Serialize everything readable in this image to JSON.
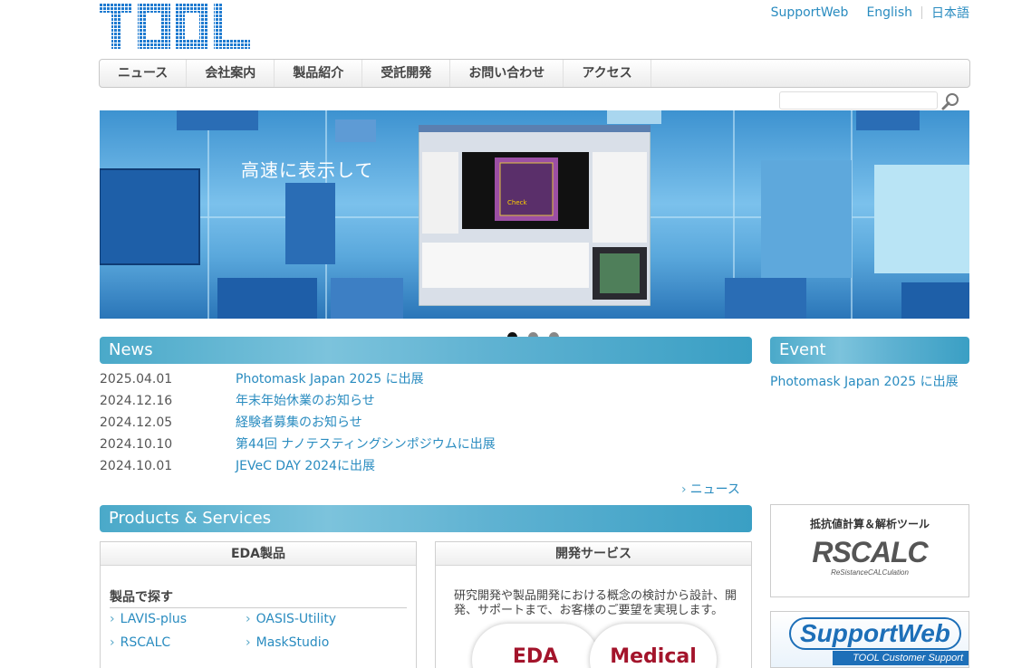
{
  "header": {
    "logo_text": "TOOL",
    "links": [
      "SupportWeb",
      "English",
      "日本語"
    ]
  },
  "nav": {
    "items": [
      "ニュース",
      "会社案内",
      "製品紹介",
      "受託開発",
      "お問い合わせ",
      "アクセス"
    ]
  },
  "search": {
    "value": ""
  },
  "hero": {
    "caption": "高速に表示して",
    "check_label": "Check",
    "slides": 3,
    "active_slide": 1
  },
  "news": {
    "title": "News",
    "items": [
      {
        "date": "2025.04.01",
        "title": "Photomask Japan 2025 に出展"
      },
      {
        "date": "2024.12.16",
        "title": "年末年始休業のお知らせ"
      },
      {
        "date": "2024.12.05",
        "title": "経験者募集のお知らせ"
      },
      {
        "date": "2024.10.10",
        "title": "第44回 ナノテスティングシンポジウムに出展"
      },
      {
        "date": "2024.10.01",
        "title": "JEVeC DAY 2024に出展"
      }
    ],
    "more_label": "ニュース"
  },
  "event": {
    "title": "Event",
    "items": [
      "Photomask Japan 2025 に出展"
    ]
  },
  "products": {
    "title": "Products & Services",
    "eda": {
      "header": "EDA製品",
      "subheader": "製品で探す",
      "links": [
        "LAVIS-plus",
        "OASIS-Utility",
        "RSCALC",
        "MaskStudio"
      ]
    },
    "dev": {
      "header": "開発サービス",
      "text": "研究開発や製品開発における概念の検討から設計、開発、サポートまで、お客様のご要望を実現します。",
      "circles": [
        "EDA",
        "Medical"
      ]
    }
  },
  "sidebar": {
    "rscalc_caption": "抵抗値計算＆解析ツール",
    "rscalc_logo": "RSCALC",
    "rscalc_sub": "ReSistanceCALCulation",
    "supportweb_logo": "SupportWeb",
    "supportweb_sub": "TOOL Customer Support"
  },
  "colors": {
    "link": "#2a8cc0",
    "bar": "#4aa9c9",
    "logo": "#1f7bd0",
    "circle_text": "#a3142b"
  }
}
